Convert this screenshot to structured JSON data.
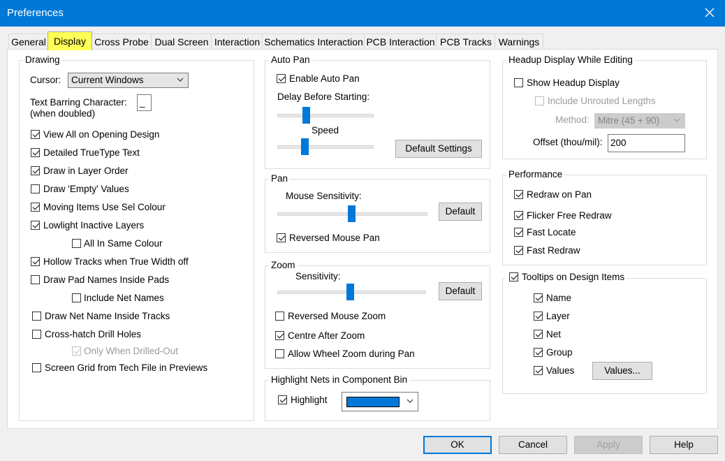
{
  "window": {
    "title": "Preferences"
  },
  "tabs": [
    "General",
    "Display",
    "Cross Probe",
    "Dual Screen",
    "Interaction",
    "Schematics Interaction",
    "PCB Interaction",
    "PCB Tracks",
    "Warnings"
  ],
  "drawing": {
    "title": "Drawing",
    "cursor_label": "Cursor:",
    "cursor_value": "Current Windows",
    "text_barring_label": "Text Barring Character:",
    "text_barring_sub": "(when doubled)",
    "text_barring_value": "_",
    "options": [
      {
        "label": "View All on Opening Design",
        "checked": true
      },
      {
        "label": "Detailed TrueType Text",
        "checked": true
      },
      {
        "label": "Draw in Layer Order",
        "checked": true
      },
      {
        "label": "Draw 'Empty' Values",
        "checked": false
      },
      {
        "label": "Moving Items Use Sel Colour",
        "checked": true
      },
      {
        "label": "Lowlight Inactive Layers",
        "checked": true
      },
      {
        "label": "All In Same Colour",
        "checked": false
      },
      {
        "label": "Hollow Tracks when True Width off",
        "checked": true
      },
      {
        "label": "Draw Pad Names Inside Pads",
        "checked": false
      },
      {
        "label": "Include Net Names",
        "checked": false
      },
      {
        "label": "Draw Net Name Inside Tracks",
        "checked": false
      },
      {
        "label": "Cross-hatch Drill Holes",
        "checked": false
      },
      {
        "label": "Only When Drilled-Out",
        "checked": true
      },
      {
        "label": "Screen Grid from Tech File in Previews",
        "checked": false
      }
    ]
  },
  "autopan": {
    "title": "Auto Pan",
    "enable_label": "Enable Auto Pan",
    "delay_label": "Delay Before Starting:",
    "speed_label": "Speed",
    "default_settings_label": "Default Settings"
  },
  "pan": {
    "title": "Pan",
    "sensitivity_label": "Mouse Sensitivity:",
    "default_label": "Default",
    "reversed_label": "Reversed Mouse Pan"
  },
  "zoom": {
    "title": "Zoom",
    "sensitivity_label": "Sensitivity:",
    "default_label": "Default",
    "reversed_label": "Reversed Mouse Zoom",
    "centre_label": "Centre After Zoom",
    "wheel_label": "Allow Wheel Zoom during Pan"
  },
  "highlight": {
    "title": "Highlight Nets in Component Bin",
    "label": "Highlight",
    "color": "#0078d7"
  },
  "headup": {
    "title": "Headup Display While Editing",
    "show_label": "Show Headup Display",
    "unrouted_label": "Include Unrouted Lengths",
    "method_label": "Method:",
    "method_value": "Mitre (45 + 90)",
    "offset_label": "Offset (thou/mil):",
    "offset_value": "200"
  },
  "performance": {
    "title": "Performance",
    "options": [
      "Redraw on Pan",
      "Flicker Free Redraw",
      "Fast Locate",
      "Fast Redraw"
    ]
  },
  "tooltips": {
    "title": "Tooltips on Design Items",
    "items": [
      "Name",
      "Layer",
      "Net",
      "Group",
      "Values"
    ],
    "values_button": "Values..."
  },
  "footer": {
    "ok": "OK",
    "cancel": "Cancel",
    "apply": "Apply",
    "help": "Help"
  }
}
